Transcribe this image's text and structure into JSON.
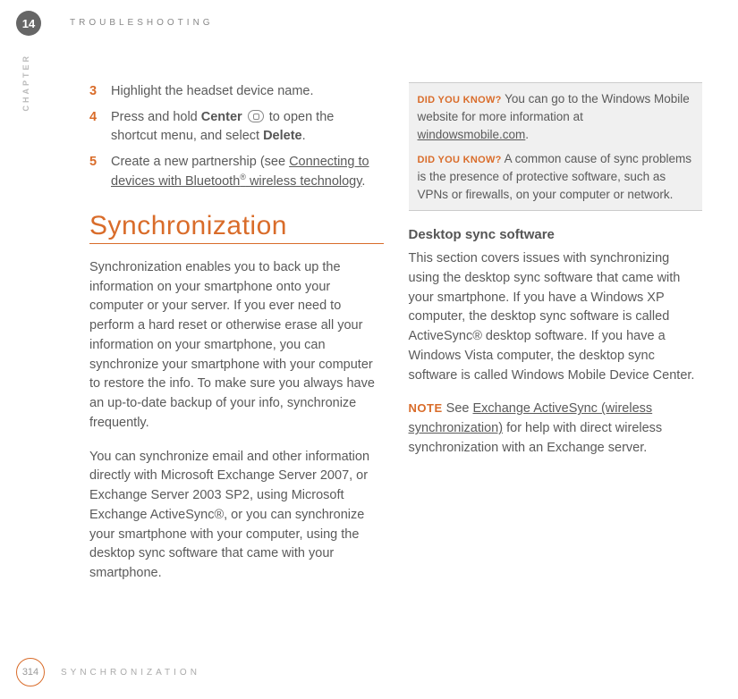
{
  "header": {
    "chapter_number": "14",
    "title": "TROUBLESHOOTING",
    "chapter_label": "CHAPTER"
  },
  "left": {
    "steps": [
      {
        "num": "3",
        "text": "Highlight the headset device name."
      },
      {
        "num": "4",
        "pre": "Press and hold ",
        "b1": "Center",
        "mid": " to open the shortcut menu, and select ",
        "b2": "Delete",
        "post": "."
      },
      {
        "num": "5",
        "pre": "Create a new partnership (see ",
        "link": "Connecting to devices with Bluetooth",
        "regmark": "®",
        "link2": "wireless technology",
        "post": "."
      }
    ],
    "section_title": "Synchronization",
    "para1": "Synchronization enables you to back up the information on your smartphone onto your computer or your server. If you ever need to perform a hard reset or otherwise erase all your information on your smartphone, you can synchronize your smartphone with your computer to restore the info. To make sure you always have an up-to-date backup of your info, synchronize frequently.",
    "para2": "You can synchronize email and other information directly with Microsoft Exchange Server 2007, or Exchange Server 2003 SP2, using Microsoft Exchange ActiveSync®, or you can synchronize your smartphone with your computer, using the desktop sync software that came with your smartphone."
  },
  "right": {
    "dyk_label": "DID YOU KNOW?",
    "dyk1_pre": "  You can go to the Windows Mobile website for more information at ",
    "dyk1_link": "windowsmobile.com",
    "dyk1_post": ".",
    "dyk2": "  A common cause of sync problems is the presence of protective software, such as VPNs or firewalls, on your computer or network.",
    "subhead": "Desktop sync software",
    "para3": "This section covers issues with synchronizing using the desktop sync software that came with your smartphone. If you have a Windows XP computer, the desktop sync software is called ActiveSync® desktop software. If you have a Windows Vista computer, the desktop sync software is called Windows Mobile Device Center.",
    "note_label": "NOTE",
    "note_pre": "  See ",
    "note_link": "Exchange ActiveSync (wireless synchronization)",
    "note_post": " for help with direct wireless synchronization with an Exchange server."
  },
  "footer": {
    "page": "314",
    "title": "SYNCHRONIZATION"
  }
}
